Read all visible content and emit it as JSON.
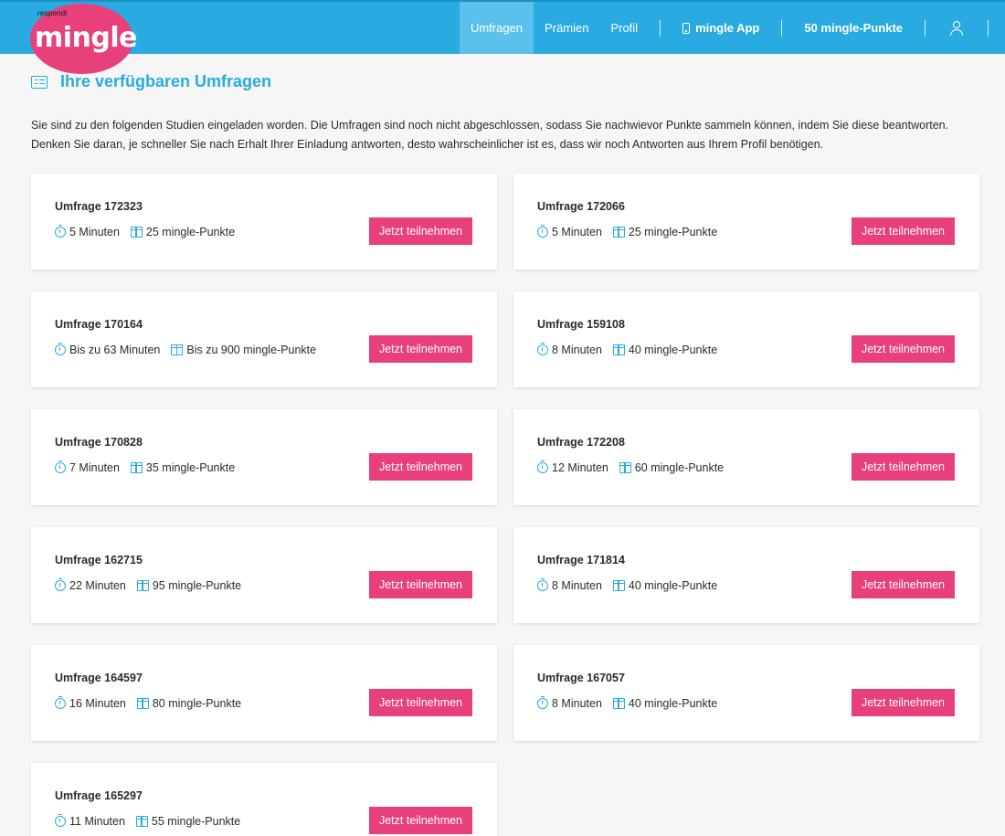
{
  "brand": {
    "small": "respondi",
    "name": "mingle",
    "color": "#e8407b"
  },
  "header": {
    "bg_color": "#29abe2",
    "nav": {
      "umfragen": "Umfragen",
      "praemien": "Prämien",
      "profil": "Profil",
      "app": "mingle App",
      "points": "50 mingle-Punkte"
    }
  },
  "page": {
    "title": "Ihre verfügbaren Umfragen",
    "intro_line1": "Sie sind zu den folgenden Studien eingeladen worden. Die Umfragen sind noch nicht abgeschlossen, sodass Sie nachwievor Punkte sammeln können, indem Sie diese beantworten.",
    "intro_line2": "Denken Sie daran, je schneller Sie nach Erhalt Ihrer Einladung antworten, desto wahrscheinlicher ist es, dass wir noch Antworten aus Ihrem Profil benötigen."
  },
  "button_label": "Jetzt teilnehmen",
  "surveys": [
    {
      "title": "Umfrage 172323",
      "time": "5 Minuten",
      "points": "25 mingle-Punkte"
    },
    {
      "title": "Umfrage 172066",
      "time": "5 Minuten",
      "points": "25 mingle-Punkte"
    },
    {
      "title": "Umfrage 170164",
      "time": "Bis zu 63 Minuten",
      "points": "Bis zu 900 mingle-Punkte"
    },
    {
      "title": "Umfrage 159108",
      "time": "8 Minuten",
      "points": "40 mingle-Punkte"
    },
    {
      "title": "Umfrage 170828",
      "time": "7 Minuten",
      "points": "35 mingle-Punkte"
    },
    {
      "title": "Umfrage 172208",
      "time": "12 Minuten",
      "points": "60 mingle-Punkte"
    },
    {
      "title": "Umfrage 162715",
      "time": "22 Minuten",
      "points": "95 mingle-Punkte"
    },
    {
      "title": "Umfrage 171814",
      "time": "8 Minuten",
      "points": "40 mingle-Punkte"
    },
    {
      "title": "Umfrage 164597",
      "time": "16 Minuten",
      "points": "80 mingle-Punkte"
    },
    {
      "title": "Umfrage 167057",
      "time": "8 Minuten",
      "points": "40 mingle-Punkte"
    },
    {
      "title": "Umfrage 165297",
      "time": "11 Minuten",
      "points": "55 mingle-Punkte"
    }
  ]
}
